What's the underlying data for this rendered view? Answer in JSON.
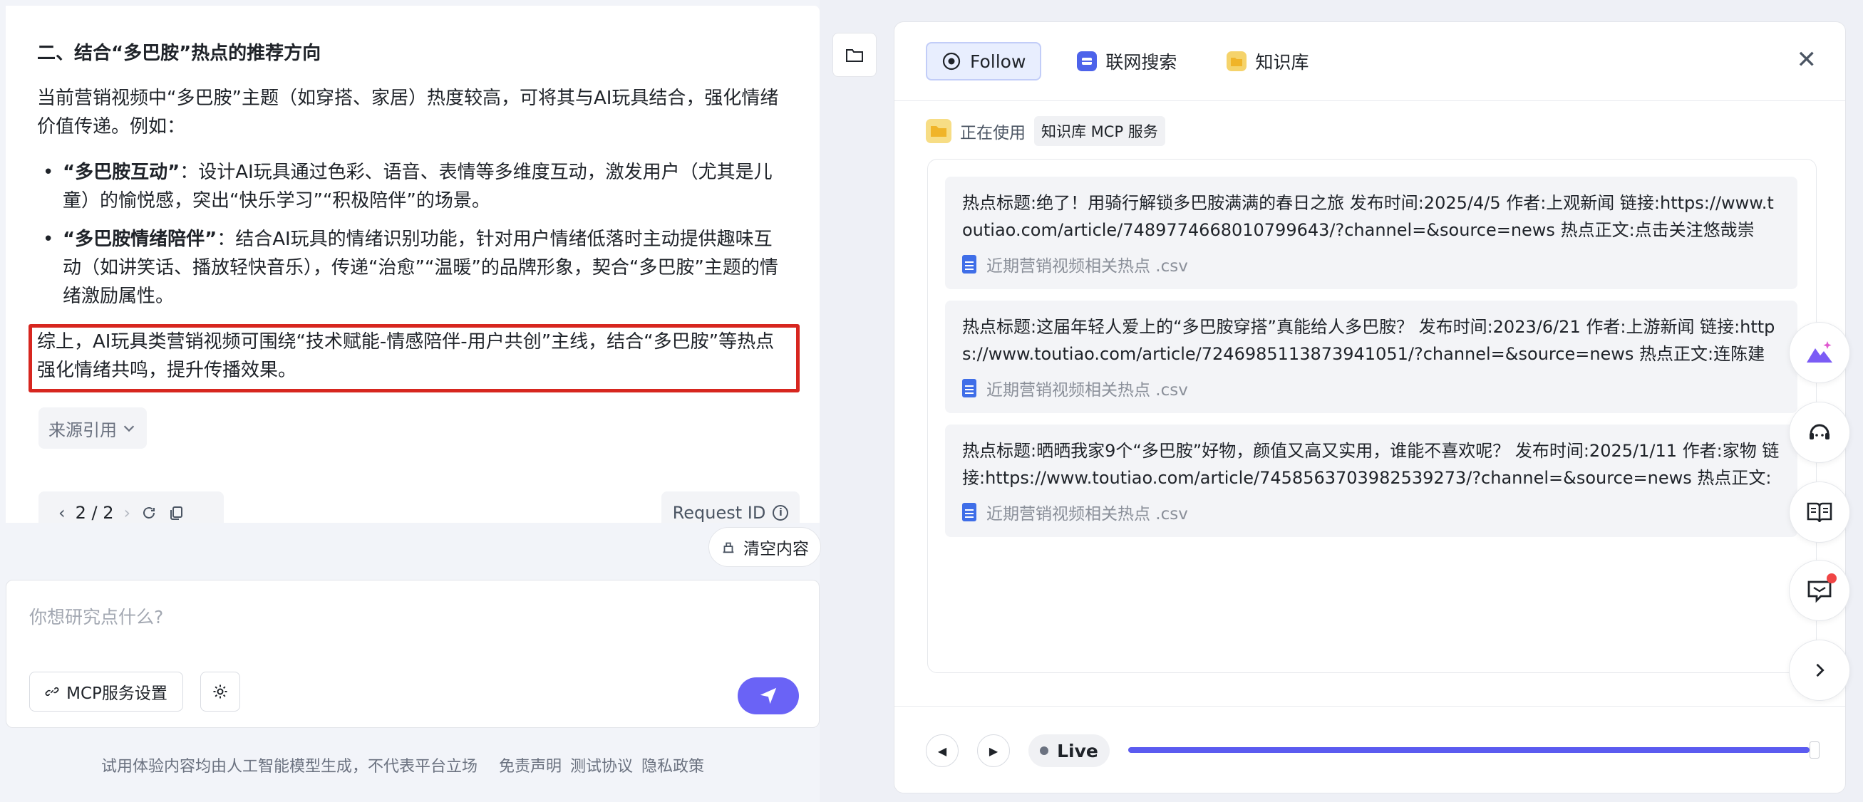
{
  "left": {
    "cut_text": "  ",
    "section_title": "二、结合“多巴胺”热点的推荐方向",
    "intro_line1": "当前营销视频中“多巴胺”主题（如穿搭、家居）热度较高，可将其与AI玩具结合，强化情绪",
    "intro_line2": "价值传递。例如：",
    "bullets": [
      {
        "term": "“多巴胺互动”",
        "line1": "：设计AI玩具通过色彩、语音、表情等多维度互动，激发用户（尤其是儿",
        "line2": "童）的愉悦感，突出“快乐学习”“积极陪伴”的场景。"
      },
      {
        "term": "“多巴胺情绪陪伴”",
        "line1": "：结合AI玩具的情绪识别功能，针对用户情绪低落时主动提供趣味互",
        "line2": "动（如讲笑话、播放轻快音乐），传递“治愈”“温暖”的品牌形象，契合“多巴胺”主题的情",
        "line3": "绪激励属性。"
      }
    ],
    "summary_line1": "综上，AI玩具类营销视频可围绕“技术赋能-情感陪伴-用户共创”主线，结合“多巴胺”等热点",
    "summary_line2": "强化情绪共鸣，提升传播效果。",
    "source_label": "来源引用",
    "pager": "2 / 2",
    "request_id_label": "Request ID",
    "clear_label": "清空内容",
    "input_placeholder": "你想研究点什么?",
    "mcp_label": "MCP服务设置",
    "footer_note": "试用体验内容均由人工智能模型生成，不代表平台立场",
    "footer_links": [
      "免责声明",
      "测试协议",
      "隐私政策"
    ]
  },
  "right": {
    "tabs": [
      {
        "label": "Follow",
        "icon": "follow-target-icon"
      },
      {
        "label": "联网搜索",
        "icon": "web-search-icon"
      },
      {
        "label": "知识库",
        "icon": "folder-icon"
      }
    ],
    "using_label": "正在使用",
    "using_pill": "知识库 MCP 服务",
    "results": [
      {
        "text": "热点标题:绝了！用骑行解锁多巴胺满满的春日之旅 发布时间:2025/4/5 作者:上观新闻 链接:https://www.toutiao.com/article/7489774668010799643/?channel=&source=news 热点正文:点击关注悠哉崇明，发…",
        "file": "近期营销视频相关热点 .csv"
      },
      {
        "text": "热点标题:这届年轻人爱上的“多巴胺穿搭”真能给人多巴胺？ 发布时间:2023/6/21 作者:上游新闻 链接:https://www.toutiao.com/article/7246985113873941051/?channel=&source=news 热点正文:连陈建斌也…",
        "file": "近期营销视频相关热点 .csv"
      },
      {
        "text": "热点标题:晒晒我家9个“多巴胺”好物，颜值又高又实用，谁能不喜欢呢？ 发布时间:2025/1/11 作者:家物 链接:https://www.toutiao.com/article/7458563703982539273/?channel=&source=news 热点正文:今…",
        "file": "近期营销视频相关热点 .csv"
      }
    ],
    "live_label": "Live",
    "progress_fraction": 0.99
  },
  "colors": {
    "accent": "#6a63f6",
    "highlight_border": "#d7261f",
    "doc_blue": "#3f6ee8",
    "folder_yellow": "#f5c542"
  }
}
